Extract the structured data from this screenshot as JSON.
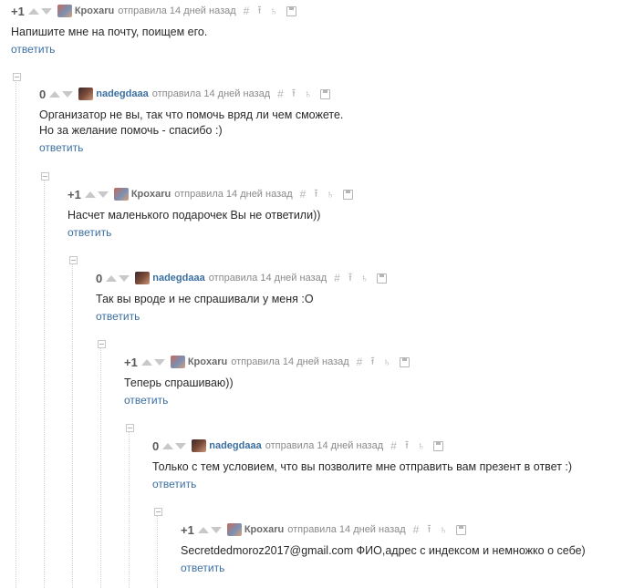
{
  "comments": [
    {
      "rating": "+1",
      "author": "Кроxaru",
      "avatar": "kroxaru",
      "meta": "отправила 14 дней назад",
      "text": [
        "Напишите мне на почту, поищем его."
      ],
      "reply": "ответить"
    },
    {
      "rating": "0",
      "author": "nadegdaaa",
      "avatar": "nadeg",
      "meta": "отправила 14 дней назад",
      "text": [
        "Организатор не вы, так что помочь вряд ли чем сможете.",
        "Но за желание помочь - спасибо :)"
      ],
      "reply": "ответить"
    },
    {
      "rating": "+1",
      "author": "Кроxaru",
      "avatar": "kroxaru",
      "meta": "отправила 14 дней назад",
      "text": [
        "Насчет маленького подарочек Вы не ответили))"
      ],
      "reply": "ответить"
    },
    {
      "rating": "0",
      "author": "nadegdaaa",
      "avatar": "nadeg",
      "meta": "отправила 14 дней назад",
      "text": [
        "Так вы вроде и не спрашивали у меня :О"
      ],
      "reply": "ответить"
    },
    {
      "rating": "+1",
      "author": "Кроxaru",
      "avatar": "kroxaru",
      "meta": "отправила 14 дней назад",
      "text": [
        "Теперь спрашиваю))"
      ],
      "reply": "ответить"
    },
    {
      "rating": "0",
      "author": "nadegdaaa",
      "avatar": "nadeg",
      "meta": "отправила 14 дней назад",
      "text": [
        "Только с тем условием, что вы позволите мне отправить вам презент в ответ :)"
      ],
      "reply": "ответить"
    },
    {
      "rating": "+1",
      "author": "Кроxaru",
      "avatar": "kroxaru",
      "meta": "отправила 14 дней назад",
      "text": [
        "Secretdedmoroz2017@gmail.com ФИО,адрес с индексом и немножко о себе)"
      ],
      "reply": "ответить"
    }
  ],
  "icons": {
    "permalink": "#",
    "parent": "⭱",
    "thread": "♄"
  }
}
